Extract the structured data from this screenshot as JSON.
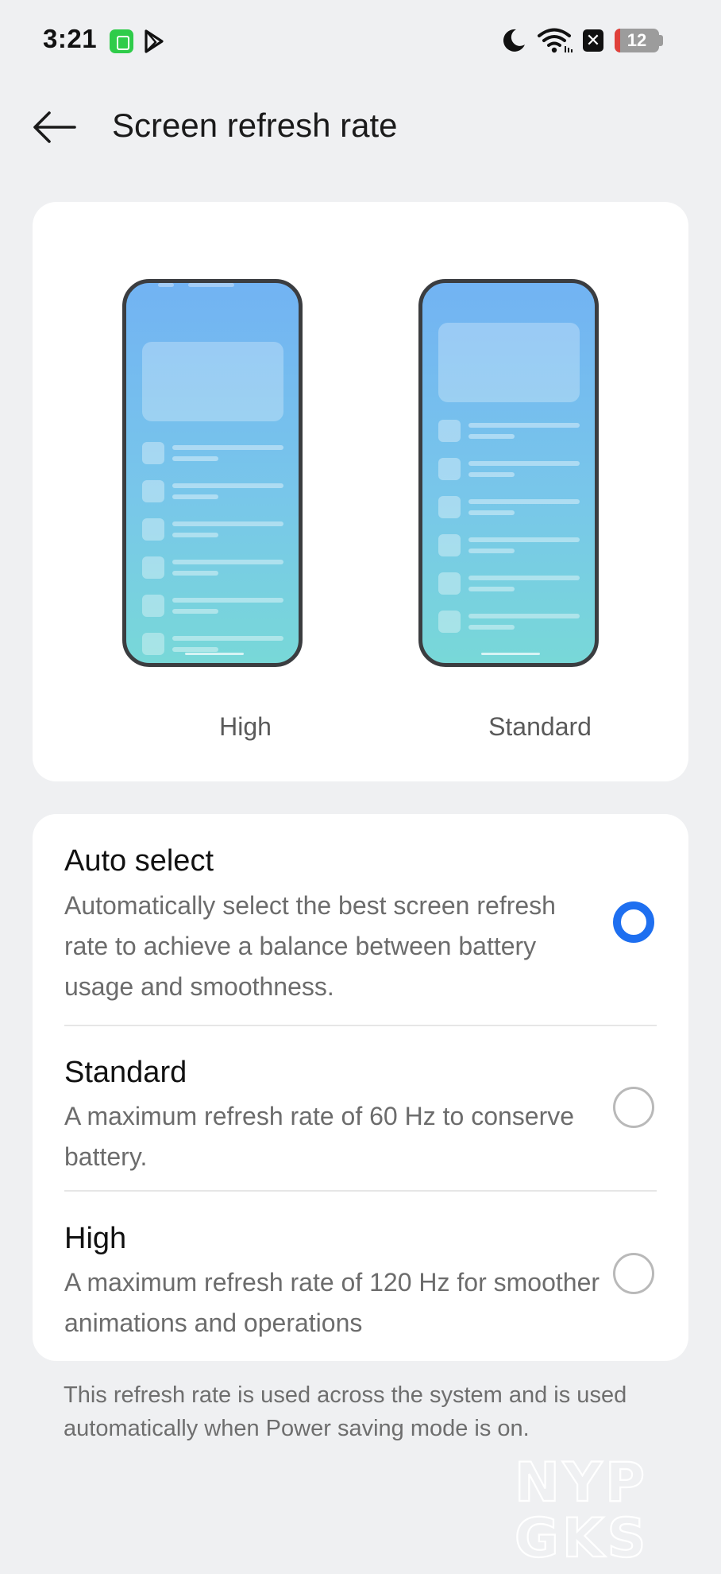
{
  "status_bar": {
    "time": "3:21",
    "battery_level": "12",
    "battery_fraction": 0.12,
    "icons": [
      "notification-app-icon",
      "play-icon",
      "do-not-disturb-moon-icon",
      "wifi-icon",
      "x-notification-icon",
      "battery-icon"
    ]
  },
  "header": {
    "back_icon": "arrow-left-icon",
    "title": "Screen refresh rate"
  },
  "preview": {
    "high_label": "High",
    "standard_label": "Standard"
  },
  "options": [
    {
      "title": "Auto select",
      "description": "Automatically select the best screen refresh rate to achieve a balance between battery usage and smoothness.",
      "selected": true
    },
    {
      "title": "Standard",
      "description": "A maximum refresh rate of 60 Hz to conserve battery.",
      "selected": false
    },
    {
      "title": "High",
      "description": "A maximum refresh rate of 120 Hz for smoother animations and operations",
      "selected": false
    }
  ],
  "footer": {
    "note": "This refresh rate is used across the system and is used automatically when Power saving mode is on."
  },
  "watermark": {
    "line1": "NYP",
    "line2": "GKS"
  },
  "colors": {
    "accent": "#1e6ff0",
    "background": "#eff0f2",
    "card": "#ffffff",
    "battery_low": "#e0403a"
  }
}
